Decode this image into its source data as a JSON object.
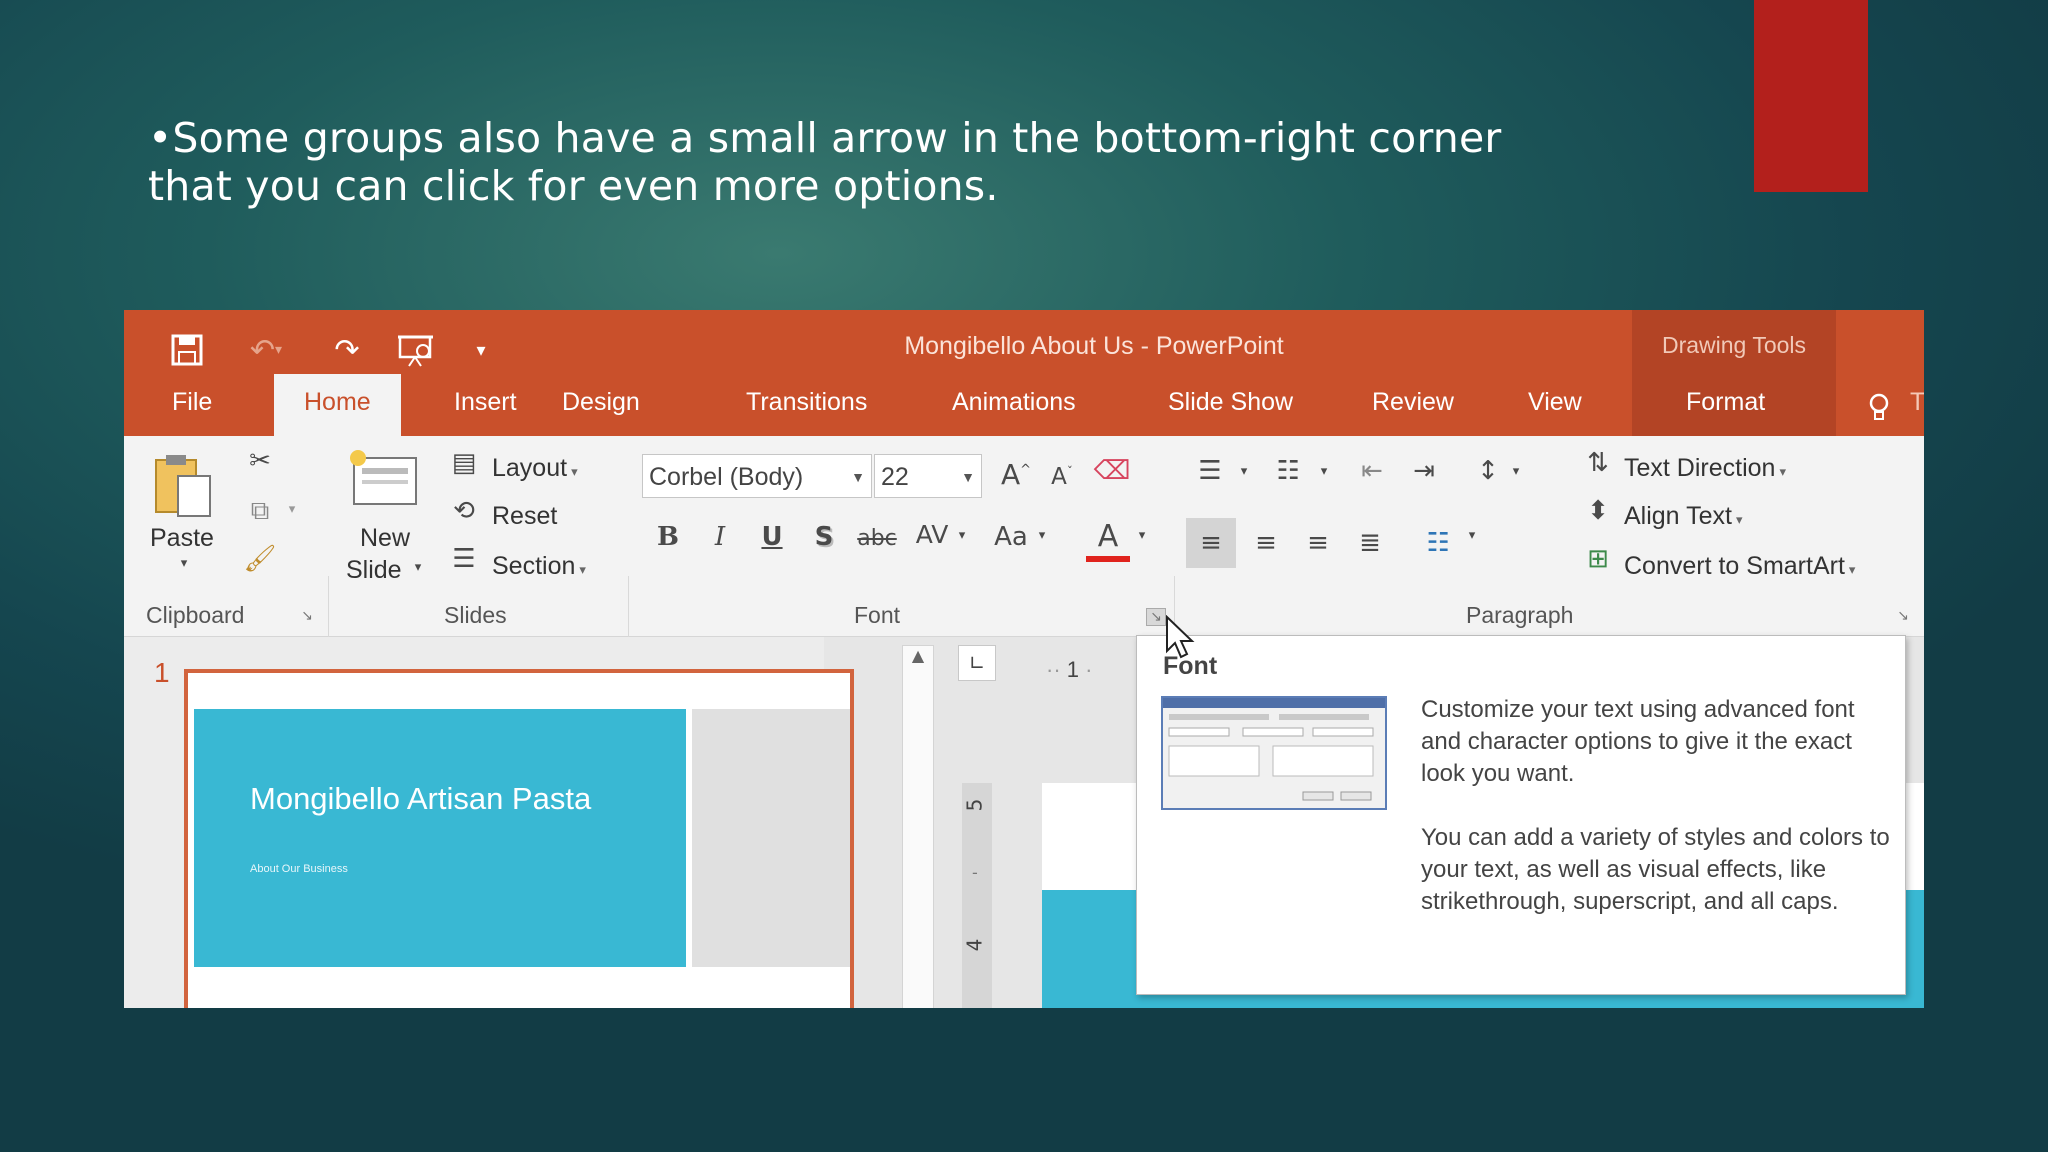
{
  "slide": {
    "bullet_text": "•Some groups also have a small arrow in the bottom-right corner that you can click for even more options.",
    "accent_bar_color": "#b3201c"
  },
  "titlebar": {
    "title": "Mongibello About Us - PowerPoint",
    "contextual_label": "Drawing Tools",
    "accent_color": "#c9502b",
    "qat_icons": [
      "save-icon",
      "undo-icon",
      "redo-icon",
      "presentation-icon",
      "customize-qat-icon"
    ]
  },
  "tabs": {
    "file": "File",
    "home": "Home",
    "insert": "Insert",
    "design": "Design",
    "transitions": "Transitions",
    "animations": "Animations",
    "slideshow": "Slide Show",
    "review": "Review",
    "view": "View",
    "format": "Format",
    "tellme_fragment": "T"
  },
  "ribbon": {
    "clipboard": {
      "label": "Clipboard",
      "paste": "Paste"
    },
    "slides": {
      "label": "Slides",
      "new_slide_1": "New",
      "new_slide_2": "Slide",
      "layout": "Layout",
      "reset": "Reset",
      "section": "Section"
    },
    "font": {
      "label": "Font",
      "font_name": "Corbel (Body)",
      "font_size": "22",
      "bold": "B",
      "italic": "I",
      "underline": "U",
      "shadow": "S",
      "strikethrough": "abc",
      "spacing": "AV",
      "change_case": "Aa",
      "font_color": "A",
      "grow": "A",
      "shrink": "A"
    },
    "paragraph": {
      "label": "Paragraph",
      "text_direction": "Text Direction",
      "align_text": "Align Text",
      "convert_smartart": "Convert to SmartArt"
    }
  },
  "workspace": {
    "slide_number": "1",
    "thumb_title": "Mongibello Artisan Pasta",
    "thumb_subtitle": "About Our Business",
    "ruler_h": "1",
    "ruler_v_5": "5",
    "ruler_v_4": "4"
  },
  "tooltip": {
    "title": "Font",
    "paragraph_1": "Customize your text using advanced font and character options to give it the exact look you want.",
    "paragraph_2": "You can add a variety of styles and colors to your text, as well as visual effects, like strikethrough, superscript, and all caps."
  }
}
